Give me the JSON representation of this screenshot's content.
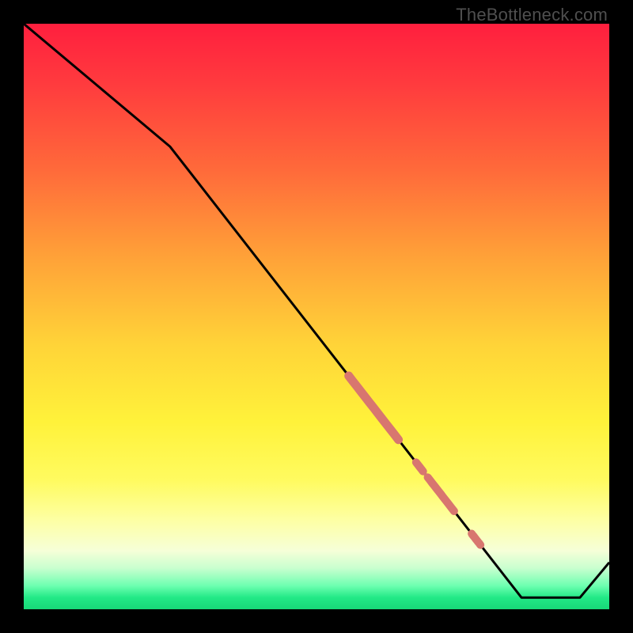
{
  "watermark": "TheBottleneck.com",
  "chart_data": {
    "type": "line",
    "title": "",
    "xlabel": "",
    "ylabel": "",
    "xlim": [
      0,
      100
    ],
    "ylim": [
      0,
      100
    ],
    "grid": false,
    "legend": false,
    "series": [
      {
        "name": "curve",
        "x": [
          0,
          25,
          85,
          95,
          100
        ],
        "y": [
          100,
          79,
          2,
          2,
          8
        ],
        "stroke": "#000000",
        "width": 2
      }
    ],
    "markers": [
      {
        "name": "band-upper",
        "x_range": [
          55.5,
          64.0
        ],
        "thickness": 11,
        "color": "#d8766f"
      },
      {
        "name": "dot-mid",
        "x_range": [
          67.0,
          68.2
        ],
        "thickness": 10,
        "color": "#d8766f"
      },
      {
        "name": "band-lower",
        "x_range": [
          69.0,
          73.5
        ],
        "thickness": 10,
        "color": "#d8766f"
      },
      {
        "name": "dot-lower",
        "x_range": [
          76.5,
          78.0
        ],
        "thickness": 10,
        "color": "#d8766f"
      }
    ],
    "background_gradient": {
      "stops": [
        {
          "pos": 0.0,
          "color": "#ff1f3e"
        },
        {
          "pos": 0.55,
          "color": "#ffd438"
        },
        {
          "pos": 0.9,
          "color": "#f6ffd8"
        },
        {
          "pos": 1.0,
          "color": "#18d878"
        }
      ]
    }
  }
}
